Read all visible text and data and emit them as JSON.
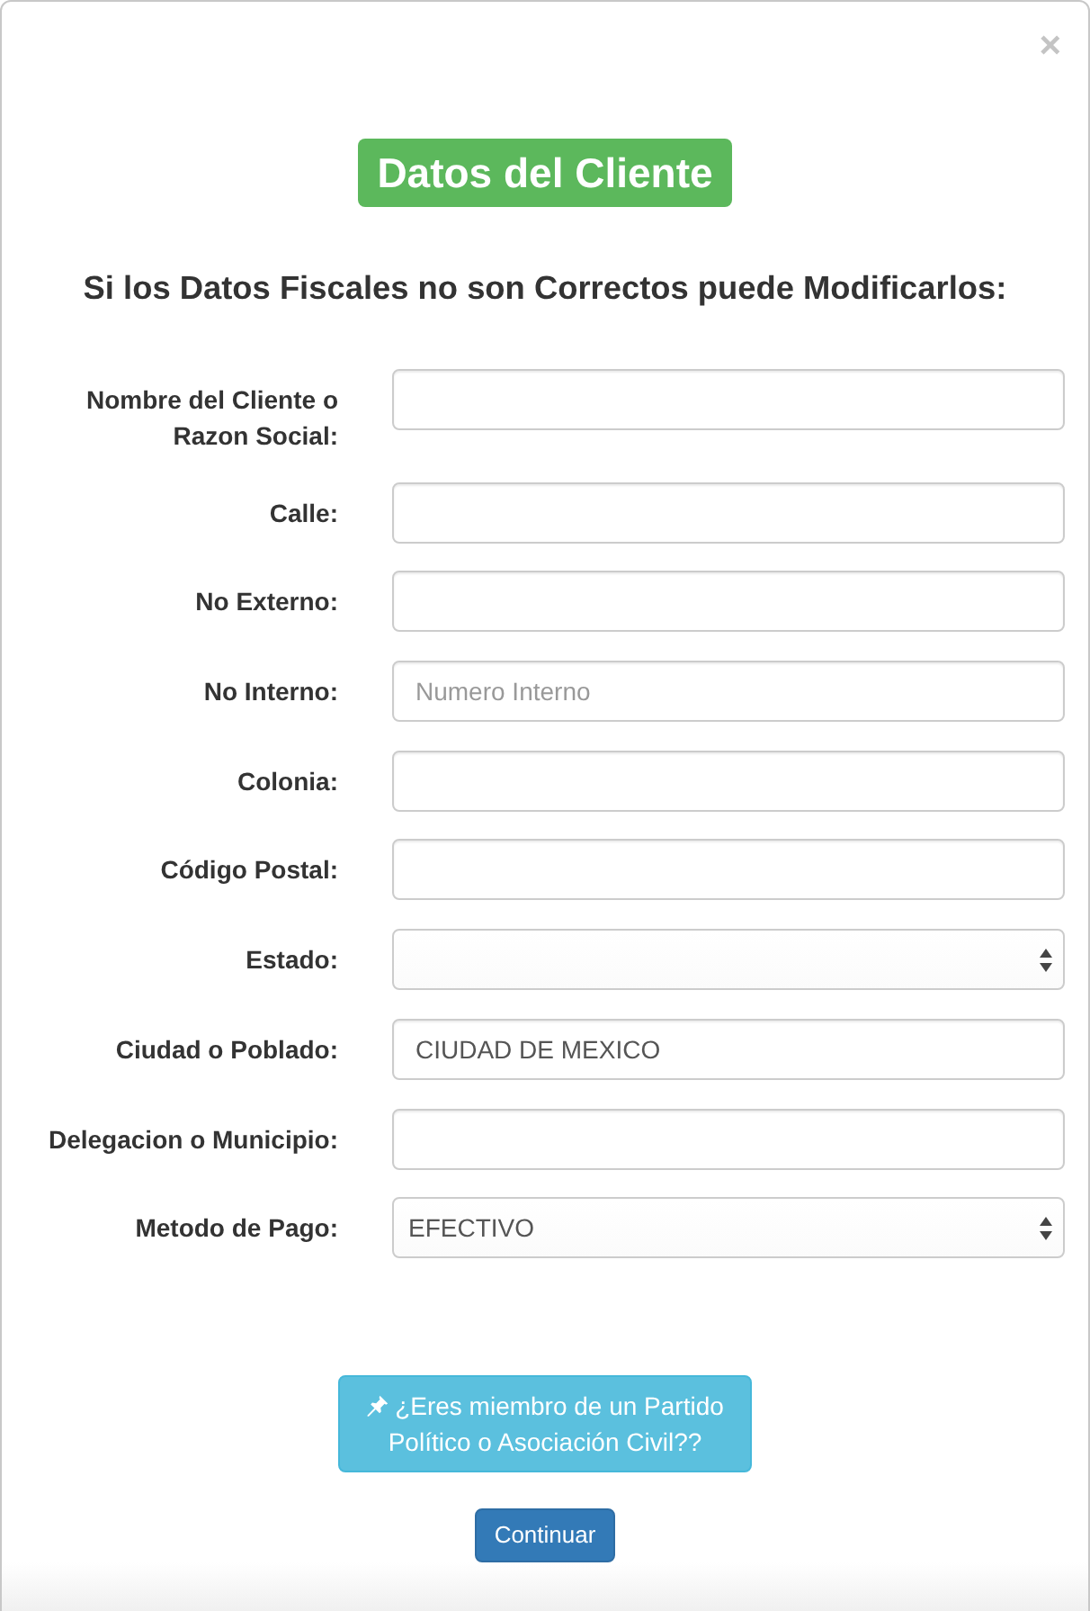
{
  "dialog": {
    "close": "×",
    "title": "Datos del Cliente",
    "subtitle": "Si los Datos Fiscales no son Correctos puede Modificarlos:"
  },
  "fields": [
    {
      "kind": "text",
      "label": "Nombre del Cliente o Razon Social:"
    },
    {
      "kind": "text",
      "label": "Calle:"
    },
    {
      "kind": "text",
      "label": "No Externo:"
    },
    {
      "kind": "text",
      "label": "No Interno:",
      "placeholder": "Numero Interno"
    },
    {
      "kind": "text",
      "label": "Colonia:"
    },
    {
      "kind": "text",
      "label": "Código Postal:"
    },
    {
      "kind": "select",
      "label": "Estado:"
    },
    {
      "kind": "text",
      "label": "Ciudad o Poblado:",
      "value": "CIUDAD DE MEXICO"
    },
    {
      "kind": "text",
      "label": "Delegacion o Municipio:"
    },
    {
      "kind": "select",
      "label": "Metodo de Pago:",
      "value": "EFECTIVO"
    }
  ],
  "buttons": [
    {
      "kind": "info",
      "label": "¿Eres miembro de un Partido Político o Asociación Civil??"
    },
    {
      "kind": "primary",
      "label": "Continuar"
    }
  ]
}
